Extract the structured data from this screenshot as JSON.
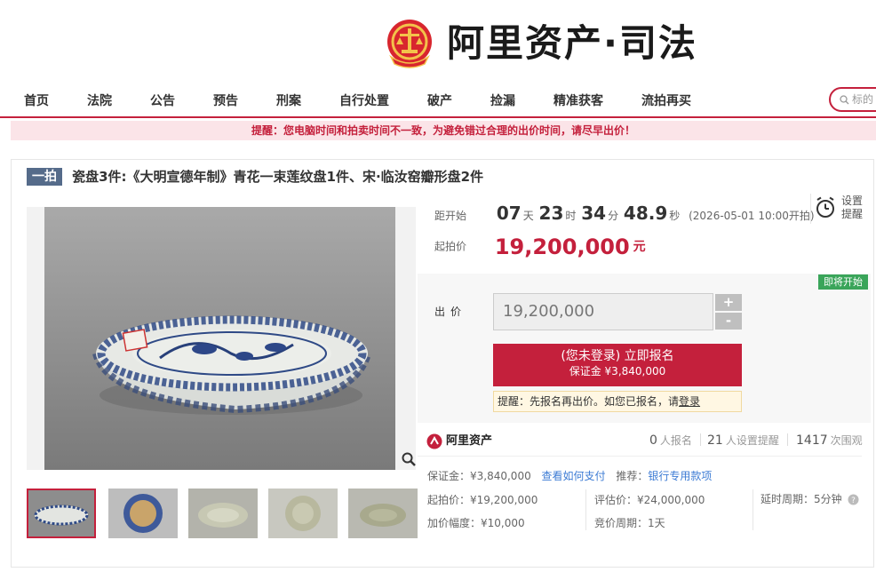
{
  "header": {
    "logo_text": "阿里资产·司法"
  },
  "nav": {
    "items": [
      "首页",
      "法院",
      "公告",
      "预告",
      "刑案",
      "自行处置",
      "破产",
      "捡漏",
      "精准获客",
      "流拍再买"
    ],
    "search_placeholder": "标的"
  },
  "warning": "提醒：您电脑时间和拍卖时间不一致，为避免错过合理的出价时间，请尽早出价！",
  "lot": {
    "badge": "一拍",
    "title": "瓷盘3件:《大明宣德年制》青花一束莲纹盘1件、宋·临汝窑瓣形盘2件"
  },
  "countdown": {
    "label": "距开始",
    "days": "07",
    "days_unit": "天",
    "hours": "23",
    "hours_unit": "时",
    "minutes": "34",
    "minutes_unit": "分",
    "seconds": "48.9",
    "seconds_unit": "秒",
    "start_time": "(2026-05-01 10:00开拍)"
  },
  "price": {
    "label": "起拍价",
    "value": "19,200,000",
    "unit": "元"
  },
  "reminder": {
    "label": "设置提醒",
    "icon": "alarm-clock-icon"
  },
  "status_badge": "即将开始",
  "bid": {
    "label": "出价",
    "input_value": "19,200,000",
    "plus": "+",
    "minus": "-",
    "signup_main": "(您未登录) 立即报名",
    "signup_sub": "保证金 ¥3,840,000",
    "tip_prefix": "提醒：先报名再出价。如您已报名，请",
    "tip_link": "登录"
  },
  "stats": {
    "brand": "阿里资产",
    "signups_count": "0",
    "signups_label": "人报名",
    "reminders_count": "21",
    "reminders_label": "人设置提醒",
    "views_count": "1417",
    "views_label": "次围观"
  },
  "details": {
    "deposit": "保证金：¥3,840,000",
    "how_to_pay": "查看如何支付",
    "recommend_label": "推荐：",
    "recommend_link": "银行专用款项",
    "start_price": "起拍价：¥19,200,000",
    "increment": "加价幅度：¥10,000",
    "appraisal": "评估价：¥24,000,000",
    "bid_cycle": "竞价周期：1天",
    "extension": "延时周期：5分钟"
  },
  "colors": {
    "brand_red": "#c4203c",
    "badge_blue": "#556b8a",
    "status_green": "#3aa55a",
    "link_blue": "#3c7bd4"
  }
}
